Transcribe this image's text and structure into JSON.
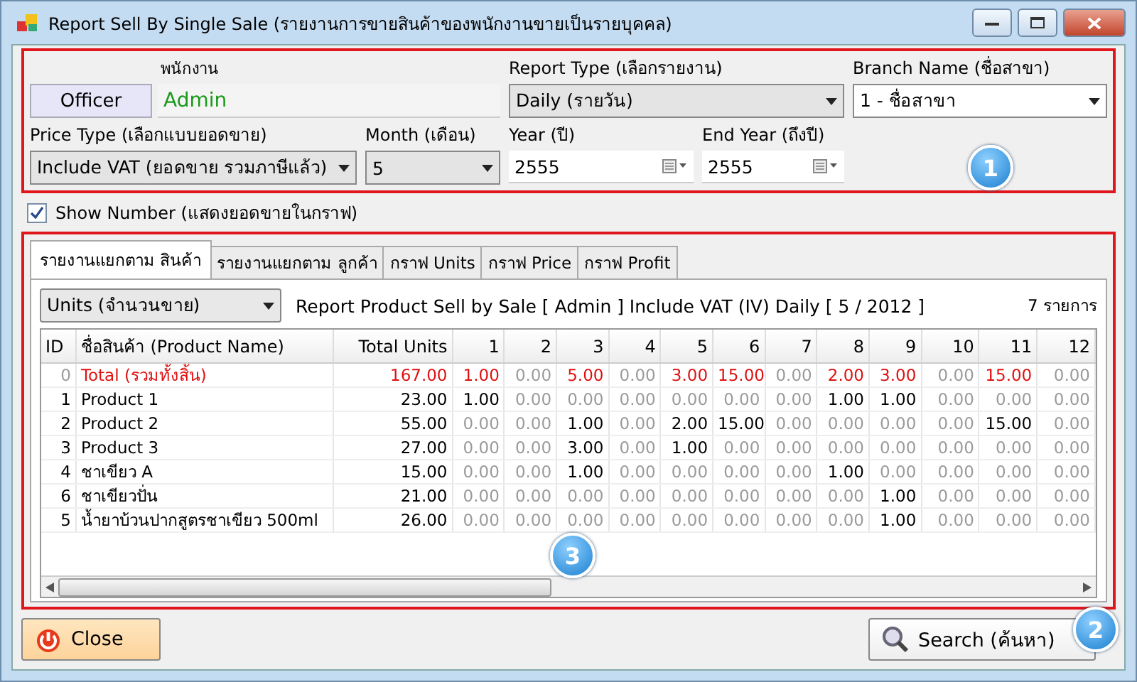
{
  "window": {
    "title": "Report Sell By Single Sale (รายงานการขายสินค้าของพนักงานขายเป็นรายบุคคล)"
  },
  "filters": {
    "officer_caption": "พนักงาน",
    "officer_button": "Officer",
    "officer_value": "Admin",
    "report_type": {
      "label": "Report Type (เลือกรายงาน)",
      "value": "Daily (รายวัน)"
    },
    "branch": {
      "label": "Branch Name (ชื่อสาขา)",
      "value": "1 - ชื่อสาขา"
    },
    "price_type": {
      "label": "Price Type (เลือกแบบยอดขาย)",
      "value": "Include VAT (ยอดขาย รวมภาษีแล้ว)"
    },
    "month": {
      "label": "Month (เดือน)",
      "value": "5"
    },
    "year": {
      "label": "Year (ปี)",
      "value": "2555"
    },
    "end_year": {
      "label": "End Year (ถึงปี)",
      "value": "2555"
    }
  },
  "show_number": {
    "label": "Show Number (แสดงยอดขายในกราฟ)",
    "checked": true
  },
  "tabs": [
    {
      "label": "รายงานแยกตาม สินค้า",
      "selected": true
    },
    {
      "label": "รายงานแยกตาม ลูกค้า",
      "selected": false
    },
    {
      "label": "กราฟ Units",
      "selected": false
    },
    {
      "label": "กราฟ Price",
      "selected": false
    },
    {
      "label": "กราฟ Profit",
      "selected": false
    }
  ],
  "measure": {
    "value": "Units (จำนวนขาย)"
  },
  "report_title": "Report Product Sell by Sale [ Admin ] Include VAT (IV) Daily [ 5 / 2012 ]",
  "item_count": "7 รายการ",
  "table": {
    "columns": [
      "ID",
      "ชื่อสินค้า  (Product Name)",
      "Total Units",
      "1",
      "2",
      "3",
      "4",
      "5",
      "6",
      "7",
      "8",
      "9",
      "10",
      "11",
      "12"
    ],
    "rows": [
      {
        "kind": "total",
        "cells": [
          "0",
          "Total  (รวมทั้งสิ้น)",
          "167.00",
          "1.00",
          "0.00",
          "5.00",
          "0.00",
          "3.00",
          "15.00",
          "0.00",
          "2.00",
          "3.00",
          "0.00",
          "15.00",
          "0.00"
        ],
        "dim": [
          true,
          false,
          false,
          false,
          true,
          false,
          true,
          false,
          false,
          true,
          false,
          false,
          true,
          false,
          true
        ]
      },
      {
        "kind": "item",
        "cells": [
          "1",
          "Product 1",
          "23.00",
          "1.00",
          "0.00",
          "0.00",
          "0.00",
          "0.00",
          "0.00",
          "0.00",
          "1.00",
          "1.00",
          "0.00",
          "0.00",
          "0.00"
        ],
        "dim": [
          false,
          false,
          false,
          false,
          true,
          true,
          true,
          true,
          true,
          true,
          false,
          false,
          true,
          true,
          true
        ]
      },
      {
        "kind": "item",
        "cells": [
          "2",
          "Product 2",
          "55.00",
          "0.00",
          "0.00",
          "1.00",
          "0.00",
          "2.00",
          "15.00",
          "0.00",
          "0.00",
          "0.00",
          "0.00",
          "15.00",
          "0.00"
        ],
        "dim": [
          false,
          false,
          false,
          true,
          true,
          false,
          true,
          false,
          false,
          true,
          true,
          true,
          true,
          false,
          true
        ]
      },
      {
        "kind": "item",
        "cells": [
          "3",
          "Product 3",
          "27.00",
          "0.00",
          "0.00",
          "3.00",
          "0.00",
          "1.00",
          "0.00",
          "0.00",
          "0.00",
          "0.00",
          "0.00",
          "0.00",
          "0.00"
        ],
        "dim": [
          false,
          false,
          false,
          true,
          true,
          false,
          true,
          false,
          true,
          true,
          true,
          true,
          true,
          true,
          true
        ]
      },
      {
        "kind": "item",
        "cells": [
          "4",
          "ชาเขียว A",
          "15.00",
          "0.00",
          "0.00",
          "1.00",
          "0.00",
          "0.00",
          "0.00",
          "0.00",
          "1.00",
          "0.00",
          "0.00",
          "0.00",
          "0.00"
        ],
        "dim": [
          false,
          false,
          false,
          true,
          true,
          false,
          true,
          true,
          true,
          true,
          false,
          true,
          true,
          true,
          true
        ]
      },
      {
        "kind": "item",
        "cells": [
          "6",
          "ชาเขียวปั่น",
          "21.00",
          "0.00",
          "0.00",
          "0.00",
          "0.00",
          "0.00",
          "0.00",
          "0.00",
          "0.00",
          "1.00",
          "0.00",
          "0.00",
          "0.00"
        ],
        "dim": [
          false,
          false,
          false,
          true,
          true,
          true,
          true,
          true,
          true,
          true,
          true,
          false,
          true,
          true,
          true
        ]
      },
      {
        "kind": "item",
        "cells": [
          "5",
          "น้ำยาบ้วนปากสูตรชาเขียว  500ml",
          "26.00",
          "0.00",
          "0.00",
          "0.00",
          "0.00",
          "0.00",
          "0.00",
          "0.00",
          "0.00",
          "1.00",
          "0.00",
          "0.00",
          "0.00"
        ],
        "dim": [
          false,
          false,
          false,
          true,
          true,
          true,
          true,
          true,
          true,
          true,
          true,
          false,
          true,
          true,
          true
        ]
      }
    ]
  },
  "buttons": {
    "close": "Close",
    "search": "Search (ค้นหา)"
  },
  "callouts": [
    "1",
    "2",
    "3"
  ]
}
